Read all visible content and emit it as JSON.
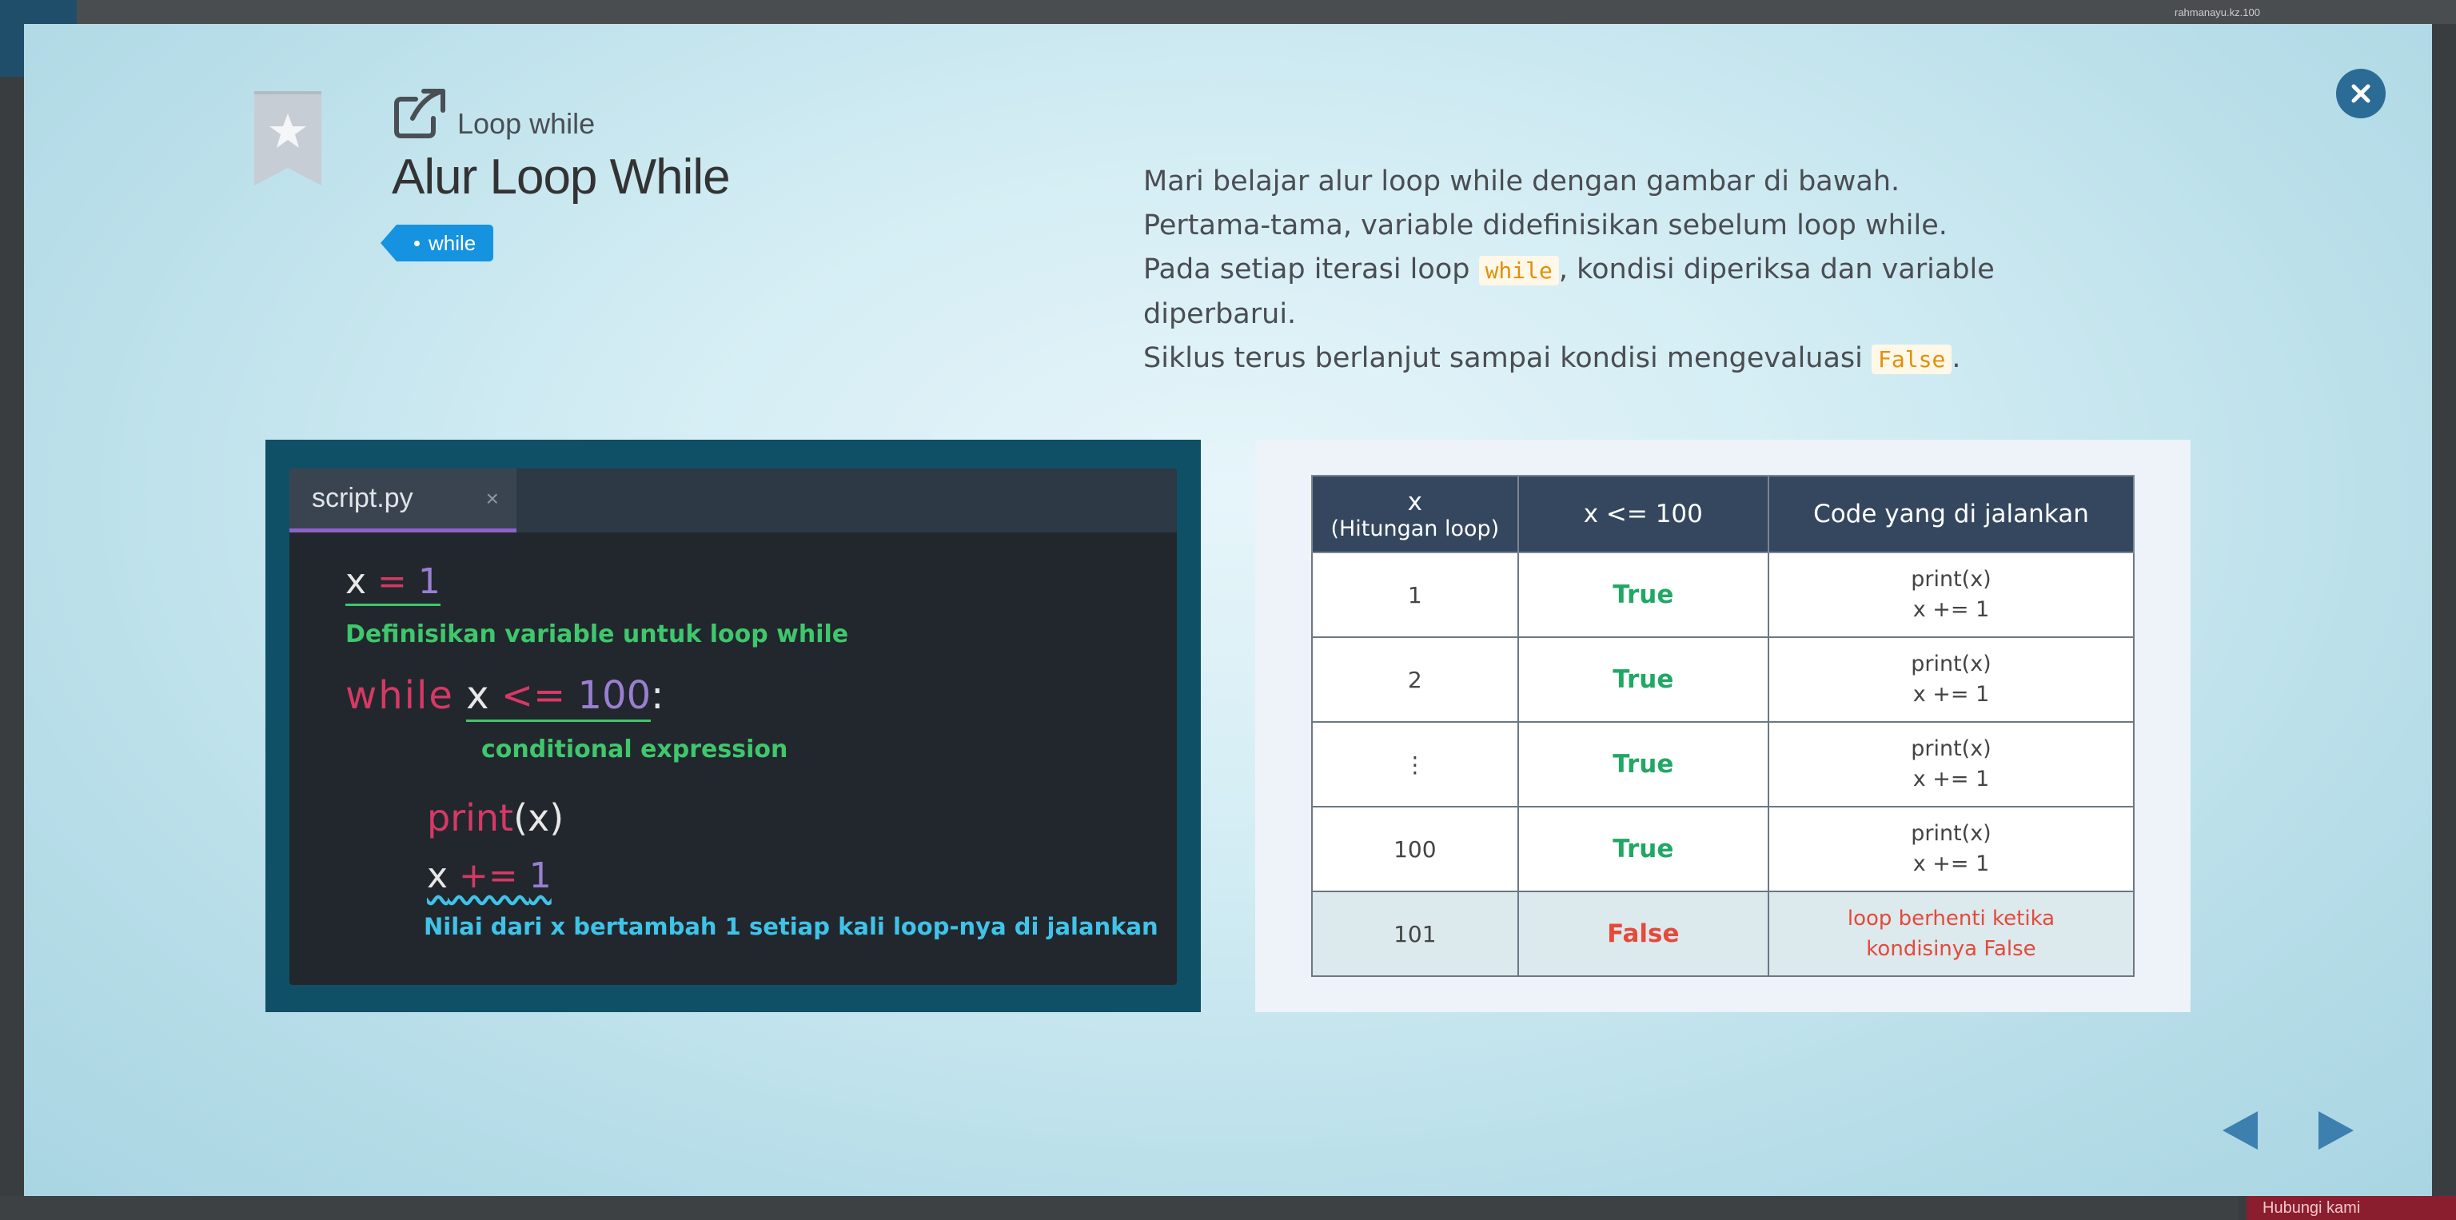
{
  "background": {
    "user_label": "rahmanayu.kz.100",
    "bottom_button": "Hubungi kami"
  },
  "modal": {
    "subtitle": "Loop while",
    "title": "Alur Loop While",
    "tag": "while",
    "description": {
      "line1": "Mari belajar alur loop while dengan gambar di bawah.",
      "line2": "Pertama-tama, variable didefinisikan sebelum loop while.",
      "line3_pre": "Pada setiap iterasi loop ",
      "line3_code": "while",
      "line3_post": ", kondisi diperiksa dan variable diperbarui.",
      "line4_pre": "Siklus terus berlanjut sampai kondisi mengevaluasi ",
      "line4_code": "False",
      "line4_post": "."
    },
    "editor": {
      "tab_name": "script.py",
      "tab_close": "×",
      "line1_var": "x",
      "line1_op": " = ",
      "line1_val": "1",
      "note1": "Definisikan variable untuk loop while",
      "line2_kw": "while",
      "line2_var": "x",
      "line2_op": " <= ",
      "line2_val": "100",
      "line2_colon": ":",
      "note2": "conditional expression",
      "line3_fn": "print",
      "line3_args": "(x)",
      "line4_var": "x",
      "line4_op": " += ",
      "line4_val": "1",
      "note3": "Nilai dari x bertambah 1 setiap kali loop-nya di jalankan"
    },
    "table": {
      "headers": {
        "col1_main": "x",
        "col1_sub": "(Hitungan loop)",
        "col2": "x <= 100",
        "col3": "Code yang di jalankan"
      },
      "rows": [
        {
          "x": "1",
          "cond": "True",
          "code1": "print(x)",
          "code2": "x += 1"
        },
        {
          "x": "2",
          "cond": "True",
          "code1": "print(x)",
          "code2": "x += 1"
        },
        {
          "x": "⋮",
          "cond": "True",
          "code1": "print(x)",
          "code2": "x += 1"
        },
        {
          "x": "100",
          "cond": "True",
          "code1": "print(x)",
          "code2": "x += 1"
        }
      ],
      "last_row": {
        "x": "101",
        "cond": "False",
        "note1": "loop berhenti ketika",
        "note2": "kondisinya False"
      }
    },
    "colors": {
      "accent": "#1693e0",
      "close": "#2a6c95",
      "true": "#20a864",
      "false": "#e5493a"
    },
    "icons": [
      "close-icon",
      "bookmark-star-icon",
      "external-link-icon",
      "arrow-left-icon",
      "arrow-right-icon"
    ]
  }
}
